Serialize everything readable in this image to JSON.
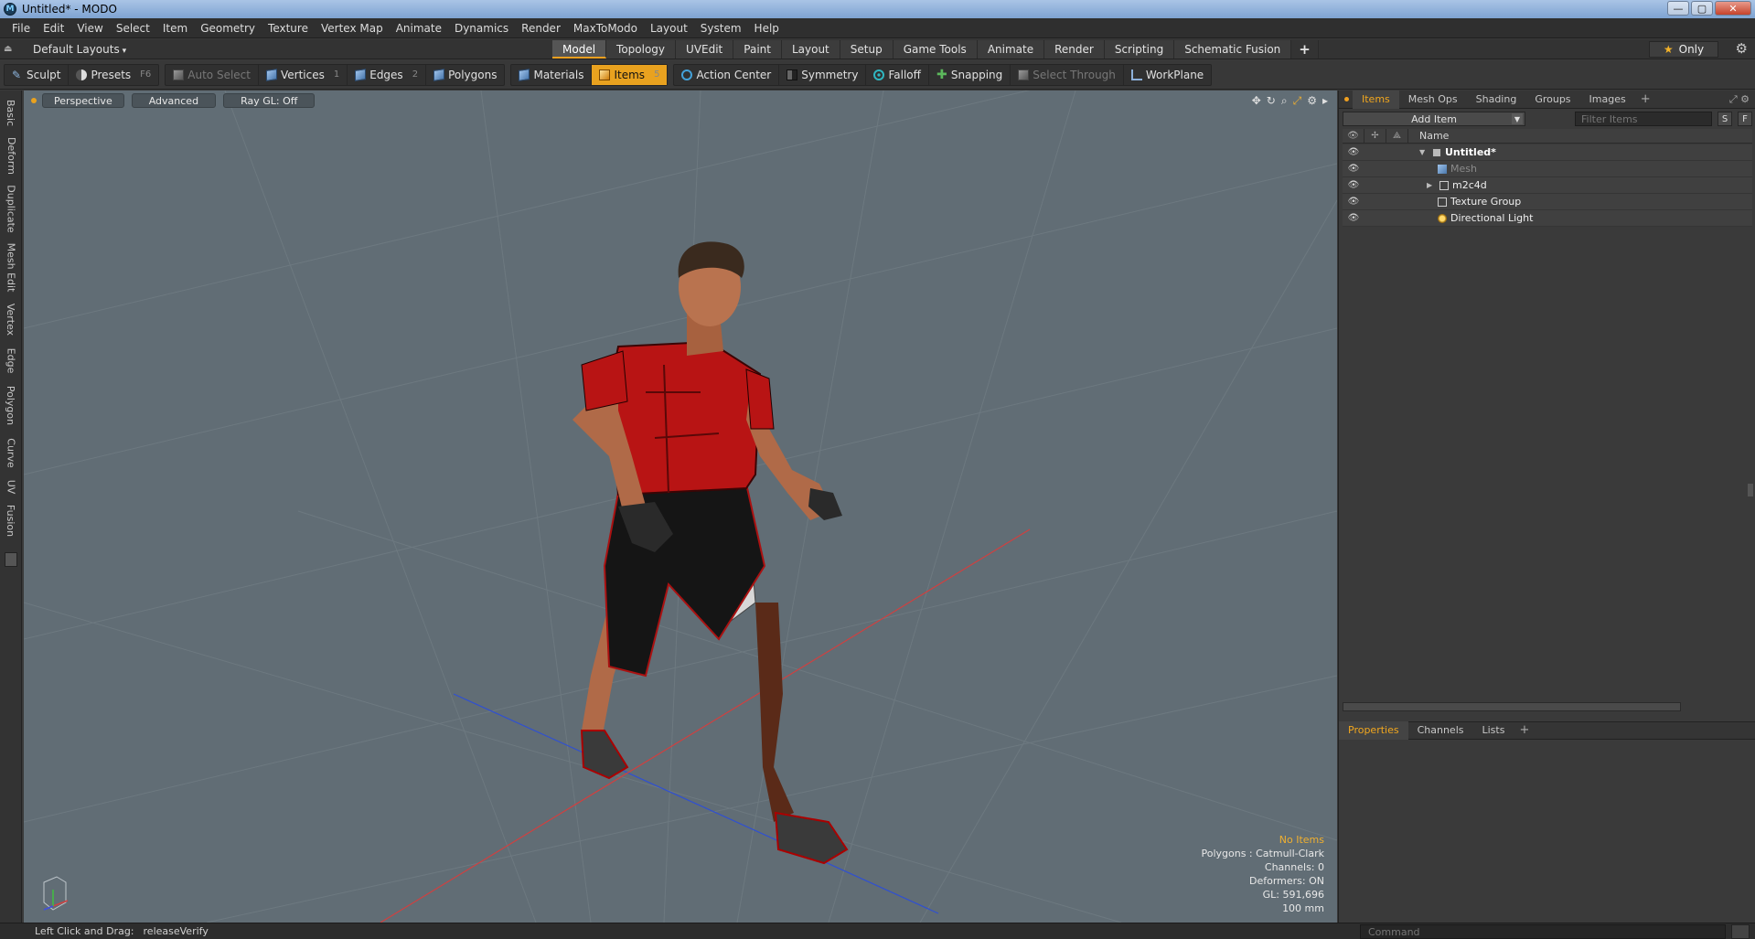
{
  "window": {
    "title": "Untitled* - MODO",
    "app_icon": "modo-logo-icon",
    "minimize": "—",
    "maximize": "▢",
    "close": "✕"
  },
  "menu": [
    "File",
    "Edit",
    "View",
    "Select",
    "Item",
    "Geometry",
    "Texture",
    "Vertex Map",
    "Animate",
    "Dynamics",
    "Render",
    "MaxToModo",
    "Layout",
    "System",
    "Help"
  ],
  "layout_bar": {
    "layouts_label": "Default Layouts",
    "tabs": [
      "Model",
      "Topology",
      "UVEdit",
      "Paint",
      "Layout",
      "Setup",
      "Game Tools",
      "Animate",
      "Render",
      "Scripting",
      "Schematic Fusion"
    ],
    "active_tab": "Model",
    "plus": "+",
    "only_label": "Only",
    "star": "★"
  },
  "toolbar": {
    "sculpt": "Sculpt",
    "presets": "Presets",
    "presets_key": "F6",
    "auto_select": "Auto Select",
    "vertices": "Vertices",
    "vertices_key": "1",
    "edges": "Edges",
    "edges_key": "2",
    "polygons": "Polygons",
    "materials": "Materials",
    "items": "Items",
    "items_key": "5",
    "action_center": "Action Center",
    "symmetry": "Symmetry",
    "falloff": "Falloff",
    "snapping": "Snapping",
    "select_through": "Select Through",
    "workplane": "WorkPlane"
  },
  "left_tabs": [
    "Basic",
    "Deform",
    "Duplicate",
    "Mesh Edit",
    "Vertex",
    "Edge",
    "Polygon",
    "Curve",
    "UV",
    "Fusion"
  ],
  "viewport": {
    "view_mode": "Perspective",
    "advanced": "Advanced",
    "raygl": "Ray GL: Off",
    "info": {
      "no_items": "No Items",
      "polygons": "Polygons : Catmull-Clark",
      "channels": "Channels: 0",
      "deformers": "Deformers: ON",
      "gl": "GL: 591,696",
      "scale": "100 mm"
    }
  },
  "items_panel": {
    "tabs": [
      "Items",
      "Mesh Ops",
      "Shading",
      "Groups",
      "Images"
    ],
    "active_tab": "Items",
    "plus": "+",
    "add_item": "Add Item",
    "filter_placeholder": "Filter Items",
    "s_btn": "S",
    "f_btn": "F",
    "name_header": "Name",
    "tree": [
      {
        "label": "Untitled*",
        "icon": "scene-icon",
        "level": 0,
        "expanded": true,
        "style": "bold"
      },
      {
        "label": "Mesh",
        "icon": "mesh-icon",
        "level": 1,
        "style": "dim"
      },
      {
        "label": "m2c4d",
        "icon": "locator-icon",
        "level": 1,
        "collapsed": true
      },
      {
        "label": "Texture Group",
        "icon": "locator-icon",
        "level": 1
      },
      {
        "label": "Directional Light",
        "icon": "light-icon",
        "level": 1
      }
    ]
  },
  "properties_panel": {
    "tabs": [
      "Properties",
      "Channels",
      "Lists"
    ],
    "active_tab": "Properties",
    "plus": "+"
  },
  "statusbar": {
    "hint": "Left Click and Drag:",
    "value": "releaseVerify",
    "command_placeholder": "Command"
  },
  "colors": {
    "accent": "#e9a21f",
    "viewport_bg": "#616d75",
    "x_axis": "#d04040",
    "z_axis": "#3050d0"
  }
}
